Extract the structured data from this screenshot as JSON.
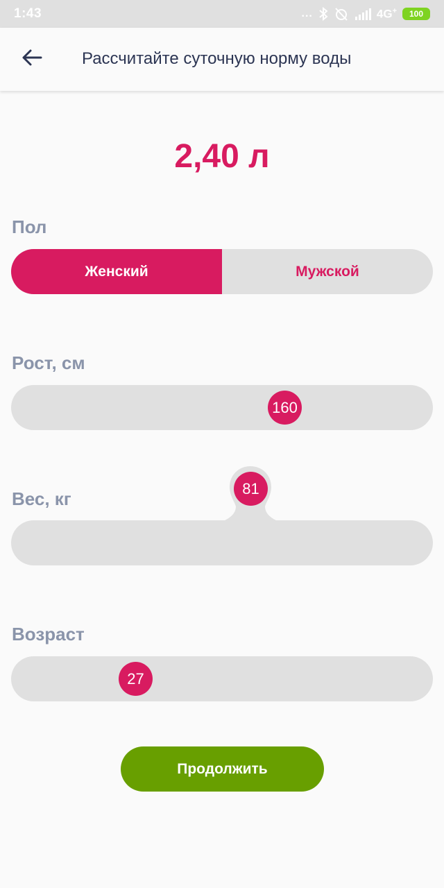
{
  "status_bar": {
    "time": "1:43",
    "signal_dots": "...",
    "network": "4G",
    "network_plus": "+",
    "battery": "100",
    "icons": [
      "bluetooth-icon",
      "alarm-off-icon",
      "signal-icon",
      "battery-icon"
    ]
  },
  "app_bar": {
    "title": "Рассчитайте суточную норму воды",
    "back_icon": "arrow-left-icon"
  },
  "result": {
    "value": "2,40 л"
  },
  "gender": {
    "label": "Пол",
    "options": [
      "Женский",
      "Мужской"
    ],
    "selected": "Женский"
  },
  "height": {
    "label": "Рост, см",
    "value": "160",
    "fraction": 0.66
  },
  "weight": {
    "label": "Вес, кг",
    "value": "81",
    "fraction": 0.54
  },
  "age": {
    "label": "Возраст",
    "value": "27",
    "fraction": 0.31
  },
  "continue_button": {
    "label": "Продолжить"
  },
  "colors": {
    "accent": "#d81b60",
    "track": "#e0e0e0",
    "button": "#689f00",
    "label": "#8a94aa",
    "title": "#2c3553"
  }
}
